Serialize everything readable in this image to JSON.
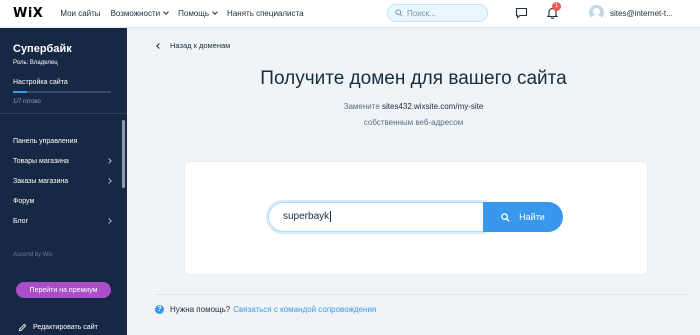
{
  "header": {
    "logo": "WiX",
    "nav": [
      {
        "label": "Мои сайты",
        "has_dropdown": false
      },
      {
        "label": "Возможности",
        "has_dropdown": true
      },
      {
        "label": "Помощь",
        "has_dropdown": true
      },
      {
        "label": "Нанять специалиста",
        "has_dropdown": false
      }
    ],
    "search_placeholder": "Поиск...",
    "notification_count": "1",
    "user_email": "sites@internet-t..."
  },
  "sidebar": {
    "site_name": "Супербайк",
    "role": "Роль: Владелец",
    "setup_title": "Настройка сайта",
    "progress_text": "1/7 готово",
    "progress_fraction": 0.14,
    "menu": [
      {
        "label": "Панель управления",
        "has_arrow": false
      },
      {
        "label": "Товары магазина",
        "has_arrow": true
      },
      {
        "label": "Заказы магазина",
        "has_arrow": true
      },
      {
        "label": "Форум",
        "has_arrow": false
      },
      {
        "label": "Блог",
        "has_arrow": true
      }
    ],
    "ascend": "Ascend by Wix",
    "premium_button": "Перейти на премиум",
    "edit_site": "Редактировать сайт"
  },
  "main": {
    "back_link": "Назад к доменам",
    "headline": "Получите домен для вашего сайта",
    "subline_prefix": "Замените",
    "subline_url": "sites432.wixsite.com/my-site",
    "subline2": "собственным веб-адресом",
    "domain_input_value": "superbayk",
    "find_button": "Найти",
    "help_question": "Нужна помощь?",
    "help_link": "Связаться с командой сопровождения"
  },
  "colors": {
    "accent": "#3899ec",
    "sidebar_bg": "#172845",
    "premium": "#aa4dc8",
    "badge": "#ee5951"
  }
}
